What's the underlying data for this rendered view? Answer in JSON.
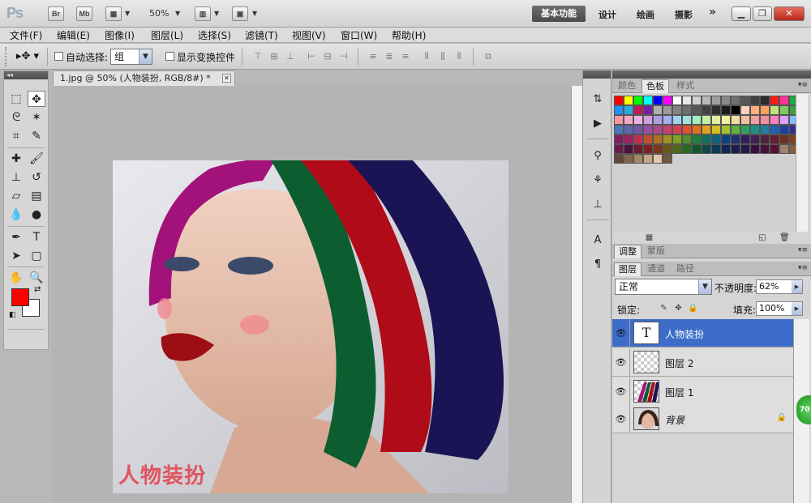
{
  "app": {
    "logo": "Ps",
    "bridge_label": "Br",
    "minibridge_label": "Mb",
    "zoom": "50%",
    "workspaces": [
      "基本功能",
      "设计",
      "绘画",
      "摄影"
    ],
    "workspace_more": "»"
  },
  "menu": [
    "文件(F)",
    "编辑(E)",
    "图像(I)",
    "图层(L)",
    "选择(S)",
    "滤镜(T)",
    "视图(V)",
    "窗口(W)",
    "帮助(H)"
  ],
  "options": {
    "auto_select_label": "自动选择:",
    "auto_select_value": "组",
    "show_transform_label": "显示变换控件"
  },
  "document": {
    "tab_title": "1.jpg @ 50% (人物装扮, RGB/8#) *",
    "overlay_text": "人物装扮"
  },
  "swatches_panel": {
    "tabs": [
      "颜色",
      "色板",
      "样式"
    ],
    "active_tab": "色板",
    "rows": [
      [
        "#ff0000",
        "#ffff00",
        "#00ff00",
        "#00ffff",
        "#0000ff",
        "#ff00ff",
        "#ffffff",
        "#e8e8e8",
        "#d0d0d0",
        "#b8b8b8",
        "#a0a0a0",
        "#888888",
        "#707070",
        "#585858",
        "#404040",
        "#2c2c2c",
        "#ff1a1a",
        "#ff3399",
        "#22aa44"
      ],
      [
        "#1e90ff",
        "#2ea8e0",
        "#c2185b",
        "#7b1fa2",
        "#b0b0b0",
        "#9a9a9a",
        "#848484",
        "#6e6e6e",
        "#585858",
        "#424242",
        "#2e2e2e",
        "#1a1a1a",
        "#000000",
        "#ffd0c0",
        "#ffb080",
        "#ffa060",
        "#c0e080",
        "#80cc60",
        "#40a040"
      ],
      [
        "#f49aa0",
        "#f7a8c8",
        "#f0b0e0",
        "#d0a0e0",
        "#b0a0e0",
        "#a0b0f0",
        "#a0d0f0",
        "#a0e0e0",
        "#a0f0c0",
        "#c0f0a0",
        "#e0f0a0",
        "#f0f0a0",
        "#f0e0a0",
        "#f0c0a0",
        "#f0a0a0",
        "#f090a0",
        "#ff80c0",
        "#e0a0ff",
        "#80c0ff"
      ],
      [
        "#4a78c0",
        "#5a68b0",
        "#7058a8",
        "#9850a0",
        "#b04890",
        "#c84070",
        "#d84050",
        "#e05030",
        "#e07020",
        "#e0a020",
        "#d0c020",
        "#a0c030",
        "#60b040",
        "#30a060",
        "#209080",
        "#2080a0",
        "#2060b0",
        "#2040a0",
        "#303090"
      ],
      [
        "#802060",
        "#a02060",
        "#c03050",
        "#c05030",
        "#b07020",
        "#a09020",
        "#80a020",
        "#509030",
        "#208040",
        "#107060",
        "#106080",
        "#104080",
        "#203070",
        "#302060",
        "#402050",
        "#502040",
        "#602030",
        "#703020",
        "#804020"
      ],
      [
        "#6a1a4a",
        "#4a1040",
        "#701830",
        "#7a2020",
        "#7a3818",
        "#6a5818",
        "#506818",
        "#286820",
        "#105830",
        "#104848",
        "#103858",
        "#102858",
        "#182050",
        "#281848",
        "#381040",
        "#481038",
        "#581030",
        "#a08070",
        "#806040"
      ],
      [
        "#604838",
        "#806850",
        "#a08868",
        "#c0a888",
        "#e0c8a8",
        "#705840"
      ]
    ]
  },
  "adjust_panel": {
    "tabs": [
      "调整",
      "蒙版"
    ]
  },
  "layers_panel": {
    "tabs": [
      "图层",
      "通道",
      "路径"
    ],
    "blend_mode": "正常",
    "opacity_label": "不透明度:",
    "opacity_value": "62%",
    "lock_label": "锁定:",
    "fill_label": "填充:",
    "fill_value": "100%",
    "layers": [
      {
        "name": "人物装扮",
        "thumb": "T",
        "selected": true
      },
      {
        "name": "图层 2",
        "selected": false
      },
      {
        "name": "图层 1",
        "selected": false
      },
      {
        "name": "背景",
        "selected": false
      }
    ]
  },
  "badge": "70",
  "colors": {
    "foreground": "#ff0000",
    "background": "#ffffff",
    "selection": "#3d6dc8",
    "overlay_text": "#e0545e"
  }
}
